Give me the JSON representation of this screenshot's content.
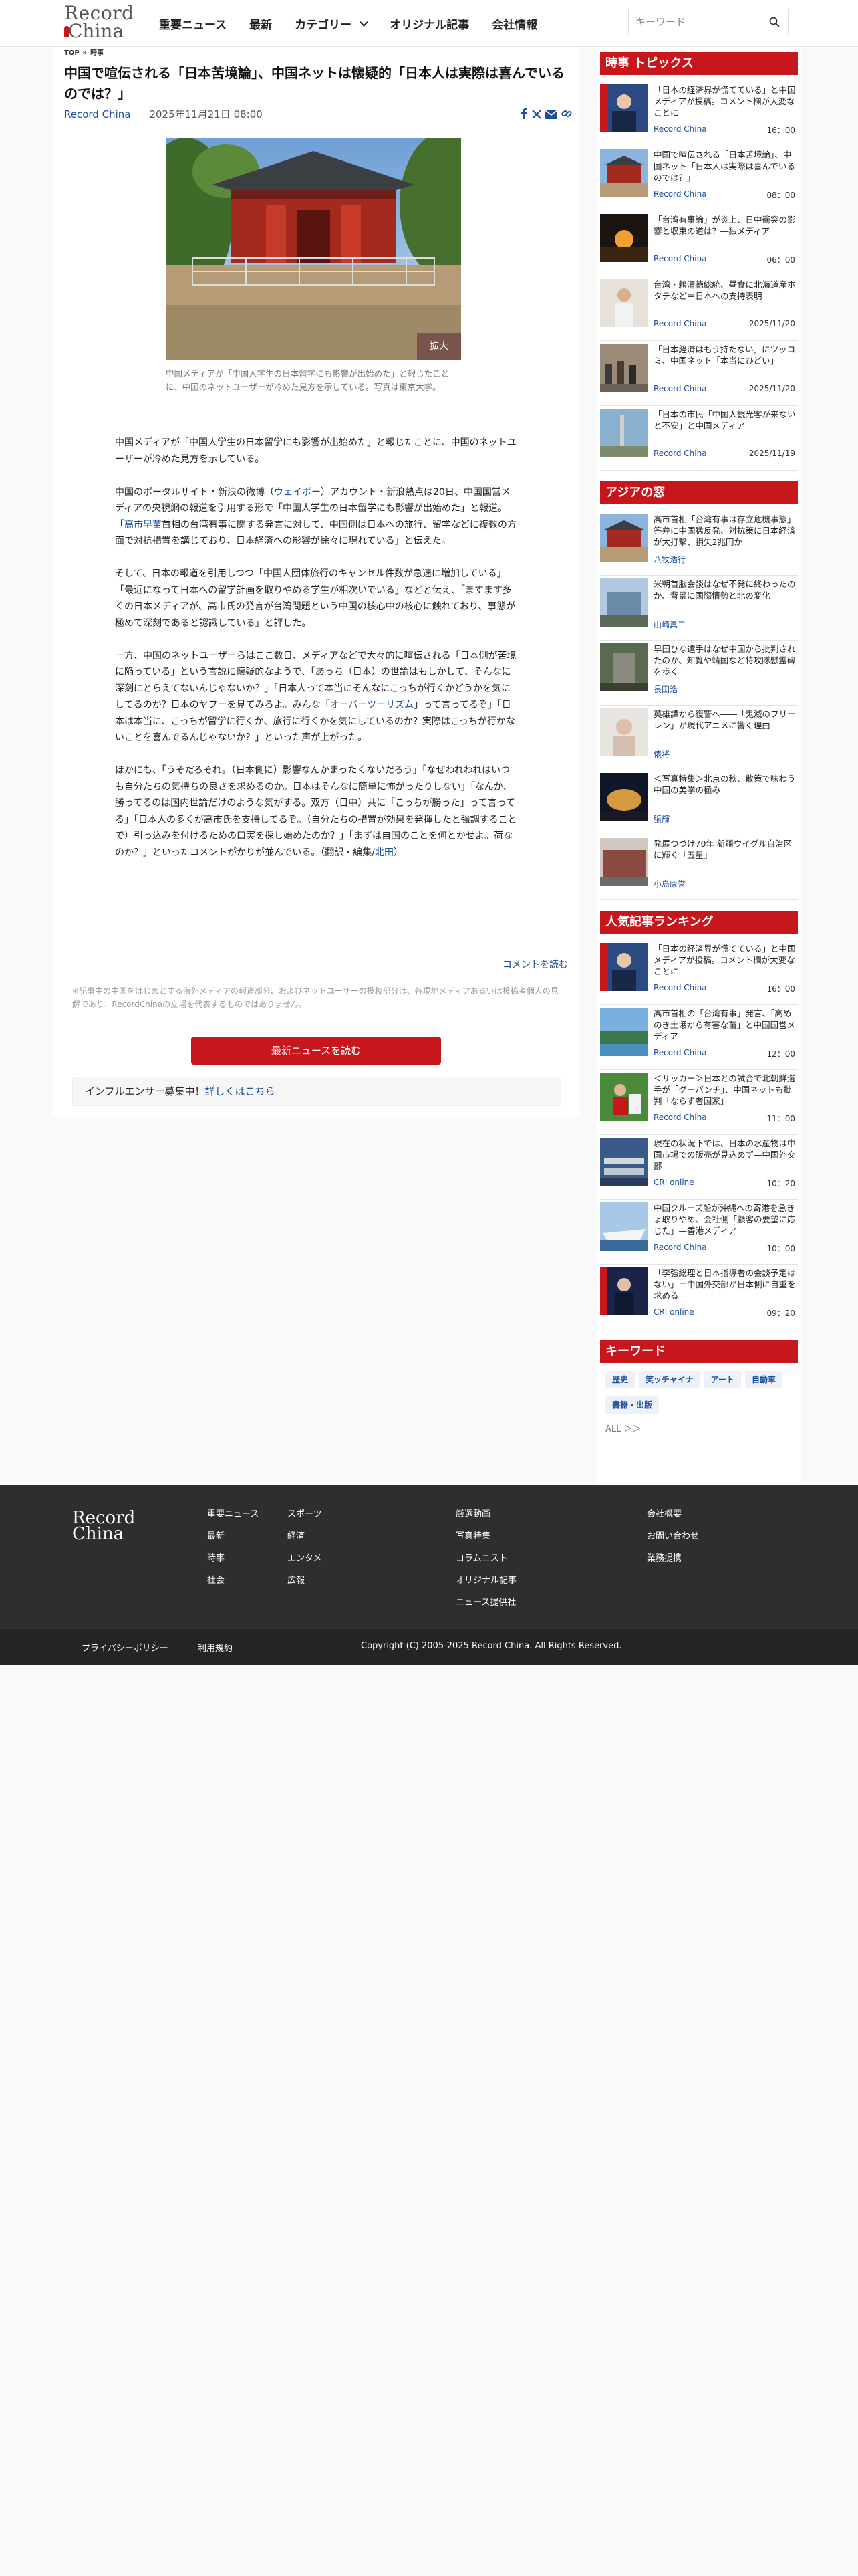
{
  "logo": {
    "line1": "Record",
    "line2": "China"
  },
  "nav": [
    "重要ニュース",
    "最新",
    "カテゴリー",
    "オリジナル記事",
    "会社情報"
  ],
  "search": {
    "placeholder": "キーワード"
  },
  "breadcrumb": {
    "home": "TOP",
    "sep": "»",
    "section": "時事"
  },
  "article": {
    "title": "中国で喧伝される「日本苦境論」、中国ネットは懐疑的「日本人は実際は喜んでいるのでは？」",
    "source": "Record China",
    "date": "2025年11月21日 08:00",
    "zoom_label": "拡大",
    "caption": "中国メディアが「中国人学生の日本留学にも影響が出始めた」と報じたことに、中国のネットユーザーが冷めた見方を示している。写真は東京大学。",
    "p1": "中国メディアが「中国人学生の日本留学にも影響が出始めた」と報じたことに、中国のネットユーザーが冷めた見方を示している。",
    "p2a": "中国のポータルサイト・新浪の微博（",
    "p2_link1": "ウェイボー",
    "p2b": "）アカウント・新浪熱点は20日、中国国営メディアの央視網の報道を引用する形で「中国人学生の日本留学にも影響が出始めた」と報道。「",
    "p2_link2": "高市早苗",
    "p2c": "首相の台湾有事に関する発言に対して、中国側は日本への旅行、留学などに複数の方面で対抗措置を講じており、日本経済への影響が徐々に現れている」と伝えた。",
    "p3": "そして、日本の報道を引用しつつ「中国人団体旅行のキャンセル件数が急速に増加している」「最近になって日本への留学計画を取りやめる学生が相次いでいる」などと伝え、「ますます多くの日本メディアが、高市氏の発言が台湾問題という中国の核心中の核心に触れており、事態が極めて深刻であると認識している」と評した。",
    "p4a": "一方、中国のネットユーザーらはここ数日、メディアなどで大々的に喧伝される「日本側が苦境に陥っている」という言説に懐疑的なようで、「あっち（日本）の世論はもしかして、そんなに深刻にとらえてないんじゃないか？」「日本人って本当にそんなにこっちが行くかどうかを気にしてるのか？日本のヤフーを見てみろよ。みんな「",
    "p4_link": "オーバーツーリズム",
    "p4b": "」って言ってるぞ」「日本は本当に、こっちが留学に行くか、旅行に行くかを気にしているのか？実際はこっちが行かないことを喜んでるんじゃないか？」といった声が上がった。",
    "p5a": "ほかにも、「うそだろそれ。（日本側に）影響なんかまったくないだろう」「なぜわれわれはいつも自分たちの気持ちの良さを求めるのか。日本はそんなに簡単に怖がったりしない」「なんか、勝ってるのは国内世論だけのような気がする。双方（日中）共に「こっちが勝った」って言ってる」「日本人の多くが高市氏を支持してるぞ。（自分たちの措置が効果を発揮したと強調することで）引っ込みを付けるための口実を探し始めたのか？」「まずは自国のことを何とかせよ。荷なのか？」といったコメントがかりが並んでいる。（翻訳・編集/",
    "p5_link": "北田",
    "p5b": "）",
    "comments_link": "コメントを読む",
    "disclaimer": "※記事中の中国をはじめとする海外メディアの報道部分、およびネットユーザーの投稿部分は、各現地メディアあるいは投稿者個人の見解であり、RecordChinaの立場を代表するものではありません。",
    "more_button": "最新ニュースを読む",
    "influencer_text": "インフルエンサー募集中！",
    "influencer_link": "詳しくはこちら"
  },
  "jiji": {
    "heading": "時事 トピックス",
    "items": [
      {
        "title": "「日本の経済界が慌てている」と中国メディアが投稿。コメント欄が大変なことに",
        "source": "Record China",
        "time": "16：00"
      },
      {
        "title": "中国で喧伝される「日本苦境論」、中国ネット「日本人は実際は喜んでいるのでは？」",
        "source": "Record China",
        "time": "08：00"
      },
      {
        "title": "「台湾有事論」が炎上、日中衝突の影響と収束の道は？―独メディア",
        "source": "Record China",
        "time": "06：00"
      },
      {
        "title": "台湾・賴清徳総統、昼食に北海道産ホタテなど＝日本への支持表明",
        "source": "Record China",
        "time": "2025/11/20"
      },
      {
        "title": "「日本経済はもう持たない」にツッコミ、中国ネット「本当にひどい」",
        "source": "Record China",
        "time": "2025/11/20"
      },
      {
        "title": "「日本の市民「中国人観光客が来ないと不安」と中国メディア",
        "source": "Record China",
        "time": "2025/11/19"
      }
    ]
  },
  "asia": {
    "heading": "アジアの窓",
    "items": [
      {
        "title": "高市首相「台湾有事は存立危機事態」答弁に中国猛反発、対抗策に日本経済が大打撃、損失2兆円か",
        "source": "八牧浩行"
      },
      {
        "title": "米朝首脳会談はなぜ不発に終わったのか、背景に国際情勢と北の変化",
        "source": "山崎真二"
      },
      {
        "title": "早田ひな選手はなぜ中国から批判されたのか、知覧や靖国など特攻隊慰霊碑を歩く",
        "source": "長田浩一"
      },
      {
        "title": "英雄譚から復讐へ――「鬼滅のフリーレン」が現代アニメに響く理由",
        "source": "俵将"
      },
      {
        "title": "＜写真特集＞北京の秋、散策で味わう中国の美学の極み",
        "source": "張輝"
      },
      {
        "title": "発展つづけ70年 新疆ウイグル自治区に輝く「五星」",
        "source": "小島康誉"
      }
    ]
  },
  "ranking": {
    "heading": "人気記事ランキング",
    "items": [
      {
        "title": "「日本の経済界が慌てている」と中国メディアが投稿。コメント欄が大変なことに",
        "source": "Record China",
        "time": "16：00"
      },
      {
        "title": "高市首相の「台湾有事」発言、「高めのき土壌から有害な苗」と中国国営メディア",
        "source": "Record China",
        "time": "12：00"
      },
      {
        "title": "＜サッカー＞日本との試合で北朝鮮選手が「グーパンチ」、中国ネットも批判「ならず者国家」",
        "source": "Record China",
        "time": "11：00"
      },
      {
        "title": "現在の状況下では、日本の水産物は中国市場での販売が見込めず—中国外交部",
        "source": "CRI online",
        "time": "10：20"
      },
      {
        "title": "中国クルーズ船が沖縄への寄港を急きょ取りやめ、会社側「顧客の要望に応じた」—香港メディア",
        "source": "Record China",
        "time": "10：00"
      },
      {
        "title": "「李強総理と日本指導者の会談予定はない」＝中国外交部が日本側に自重を求める",
        "source": "CRI online",
        "time": "09：20"
      }
    ]
  },
  "keywords": {
    "heading": "キーワード",
    "tags": [
      "歴史",
      "笑ッチャイナ",
      "アート",
      "自動車",
      "書籍・出版"
    ],
    "all": "ALL ＞＞"
  },
  "footer": {
    "col1": [
      "重要ニュース",
      "最新",
      "時事",
      "社会"
    ],
    "col2": [
      "スポーツ",
      "経済",
      "エンタメ",
      "広報"
    ],
    "col3": [
      "厳選動画",
      "写真特集",
      "コラムニスト",
      "オリジナル記事",
      "ニュース提供社"
    ],
    "col4": [
      "会社概要",
      "お問い合わせ",
      "業務提携"
    ],
    "privacy": "プライバシーポリシー",
    "terms": "利用規約",
    "copyright": "Copyright (C) 2005-2025 Record China. All Rights Reserved."
  },
  "colors": {
    "brand_red": "#c8161d",
    "link_blue": "#1d4fa0",
    "footer_bg": "#2e2e2e"
  }
}
